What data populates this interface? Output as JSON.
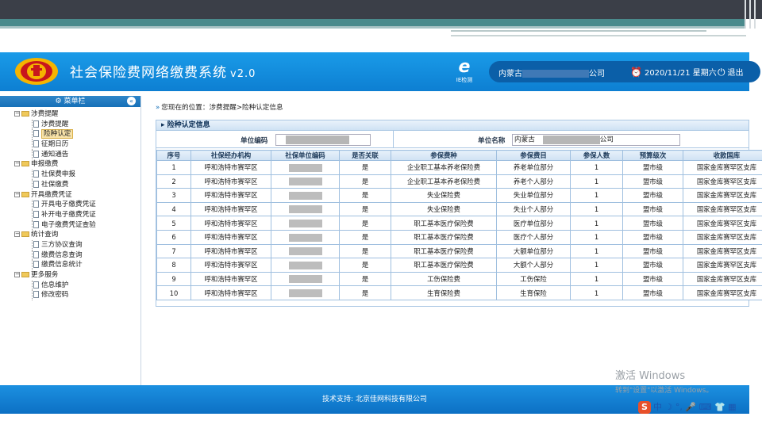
{
  "header": {
    "title": "社会保险费网络缴费系统",
    "version": "v2.0",
    "ie_check_label": "IE检测",
    "org_prefix": "内蒙古",
    "org_suffix": "公司",
    "date": "2020/11/21 星期六",
    "logout": "退出"
  },
  "sidebar": {
    "title": "菜单栏",
    "items": [
      {
        "type": "group",
        "label": "涉费提醒"
      },
      {
        "type": "leaf",
        "label": "涉费提醒"
      },
      {
        "type": "leaf",
        "label": "险种认定",
        "selected": true
      },
      {
        "type": "leaf",
        "label": "征期日历"
      },
      {
        "type": "leaf",
        "label": "通知通告"
      },
      {
        "type": "group",
        "label": "申报缴费"
      },
      {
        "type": "leaf",
        "label": "社保费申报"
      },
      {
        "type": "leaf",
        "label": "社保缴费"
      },
      {
        "type": "group",
        "label": "开具缴费凭证"
      },
      {
        "type": "leaf",
        "label": "开具电子缴费凭证"
      },
      {
        "type": "leaf",
        "label": "补开电子缴费凭证"
      },
      {
        "type": "leaf",
        "label": "电子缴费凭证查验"
      },
      {
        "type": "group",
        "label": "统计查询"
      },
      {
        "type": "leaf",
        "label": "三方协议查询"
      },
      {
        "type": "leaf",
        "label": "缴费信息查询"
      },
      {
        "type": "leaf",
        "label": "缴费信息统计"
      },
      {
        "type": "group",
        "label": "更多服务"
      },
      {
        "type": "leaf",
        "label": "信息维护"
      },
      {
        "type": "leaf",
        "label": "修改密码"
      }
    ]
  },
  "breadcrumb": {
    "prefix": "您现在的位置：",
    "path": "涉费提醒>险种认定信息"
  },
  "panel": {
    "title": "险种认定信息",
    "unit_code_label": "单位编码",
    "unit_name_label": "单位名称",
    "unit_name_prefix": "内蒙古",
    "unit_name_suffix": "公司"
  },
  "table": {
    "columns": [
      "序号",
      "社保经办机构",
      "社保单位编码",
      "是否关联",
      "参保费种",
      "参保费目",
      "参保人数",
      "预算级次",
      "收款国库"
    ],
    "rows": [
      [
        "1",
        "呼和浩特市赛罕区",
        "",
        "是",
        "企业职工基本养老保险费",
        "养老单位部分",
        "1",
        "盟市级",
        "国家金库赛罕区支库"
      ],
      [
        "2",
        "呼和浩特市赛罕区",
        "",
        "是",
        "企业职工基本养老保险费",
        "养老个人部分",
        "1",
        "盟市级",
        "国家金库赛罕区支库"
      ],
      [
        "3",
        "呼和浩特市赛罕区",
        "",
        "是",
        "失业保险费",
        "失业单位部分",
        "1",
        "盟市级",
        "国家金库赛罕区支库"
      ],
      [
        "4",
        "呼和浩特市赛罕区",
        "",
        "是",
        "失业保险费",
        "失业个人部分",
        "1",
        "盟市级",
        "国家金库赛罕区支库"
      ],
      [
        "5",
        "呼和浩特市赛罕区",
        "",
        "是",
        "职工基本医疗保险费",
        "医疗单位部分",
        "1",
        "盟市级",
        "国家金库赛罕区支库"
      ],
      [
        "6",
        "呼和浩特市赛罕区",
        "",
        "是",
        "职工基本医疗保险费",
        "医疗个人部分",
        "1",
        "盟市级",
        "国家金库赛罕区支库"
      ],
      [
        "7",
        "呼和浩特市赛罕区",
        "",
        "是",
        "职工基本医疗保险费",
        "大额单位部分",
        "1",
        "盟市级",
        "国家金库赛罕区支库"
      ],
      [
        "8",
        "呼和浩特市赛罕区",
        "",
        "是",
        "职工基本医疗保险费",
        "大额个人部分",
        "1",
        "盟市级",
        "国家金库赛罕区支库"
      ],
      [
        "9",
        "呼和浩特市赛罕区",
        "",
        "是",
        "工伤保险费",
        "工伤保险",
        "1",
        "盟市级",
        "国家金库赛罕区支库"
      ],
      [
        "10",
        "呼和浩特市赛罕区",
        "",
        "是",
        "生育保险费",
        "生育保险",
        "1",
        "盟市级",
        "国家金库赛罕区支库"
      ]
    ]
  },
  "footer": {
    "text": "技术支持: 北京佳网科技有限公司"
  },
  "watermark": {
    "line1": "激活 Windows",
    "line2": "转到\"设置\"以激活 Windows。"
  },
  "ime": {
    "text": "中"
  },
  "colors": {
    "header_blue": "#1a9be8",
    "user_box": "#0b5fa8",
    "footer_blue": "#1c90e0",
    "table_border": "#9fbfdf"
  }
}
